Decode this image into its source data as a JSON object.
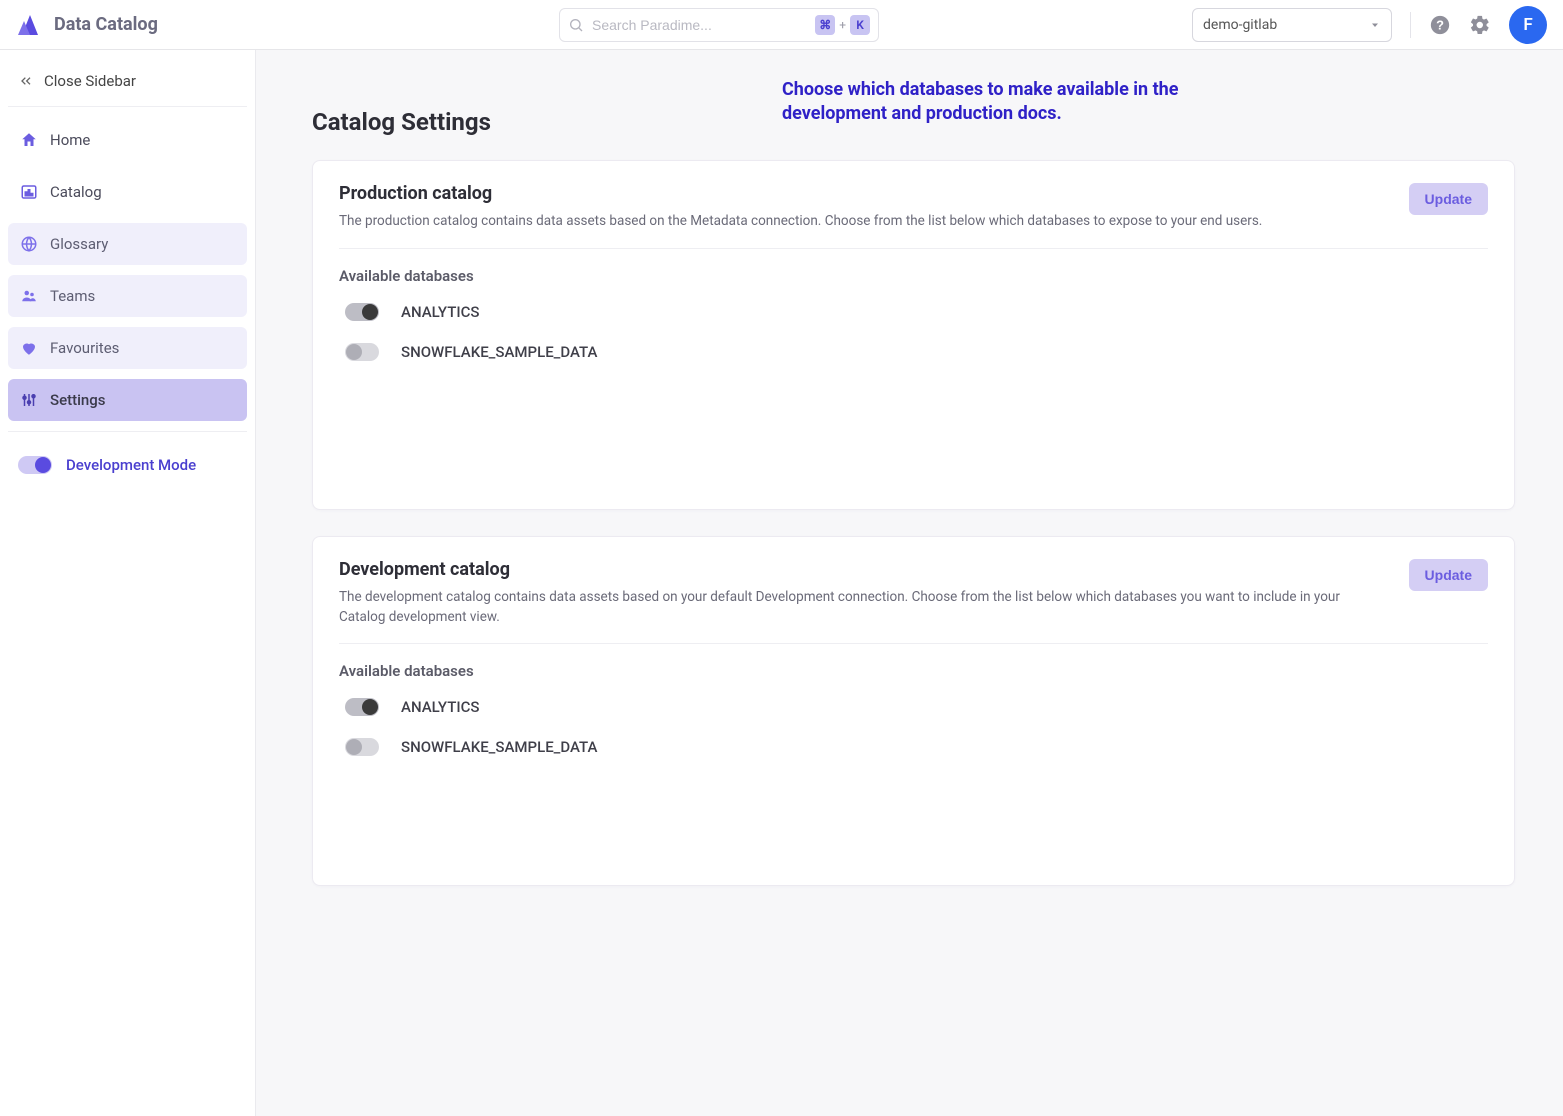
{
  "header": {
    "app_name": "Data Catalog",
    "search_placeholder": "Search Paradime...",
    "kbd1": "⌘",
    "kbd_sep": "+",
    "kbd2": "K",
    "workspace_selected": "demo-gitlab",
    "avatar_initial": "F"
  },
  "sidebar": {
    "close_label": "Close Sidebar",
    "items": [
      {
        "label": "Home",
        "style": "plain"
      },
      {
        "label": "Catalog",
        "style": "plain"
      },
      {
        "label": "Glossary",
        "style": "soft"
      },
      {
        "label": "Teams",
        "style": "soft"
      },
      {
        "label": "Favourites",
        "style": "soft"
      },
      {
        "label": "Settings",
        "style": "active"
      }
    ],
    "dev_mode_label": "Development Mode",
    "dev_mode_on": true
  },
  "page": {
    "title": "Catalog Settings",
    "callout": "Choose which databases to make available in the development and production docs."
  },
  "cards": {
    "production": {
      "title": "Production catalog",
      "desc": "The production catalog contains data assets based on the Metadata connection. Choose from the list below which databases to expose to your end users.",
      "update_label": "Update",
      "section_label": "Available databases",
      "databases": [
        {
          "name": "ANALYTICS",
          "on": true
        },
        {
          "name": "SNOWFLAKE_SAMPLE_DATA",
          "on": false
        }
      ]
    },
    "development": {
      "title": "Development catalog",
      "desc": "The development catalog contains data assets based on your default Development connection. Choose from the list below which databases you want to include in your Catalog development view.",
      "update_label": "Update",
      "section_label": "Available databases",
      "databases": [
        {
          "name": "ANALYTICS",
          "on": true
        },
        {
          "name": "SNOWFLAKE_SAMPLE_DATA",
          "on": false
        }
      ]
    }
  }
}
